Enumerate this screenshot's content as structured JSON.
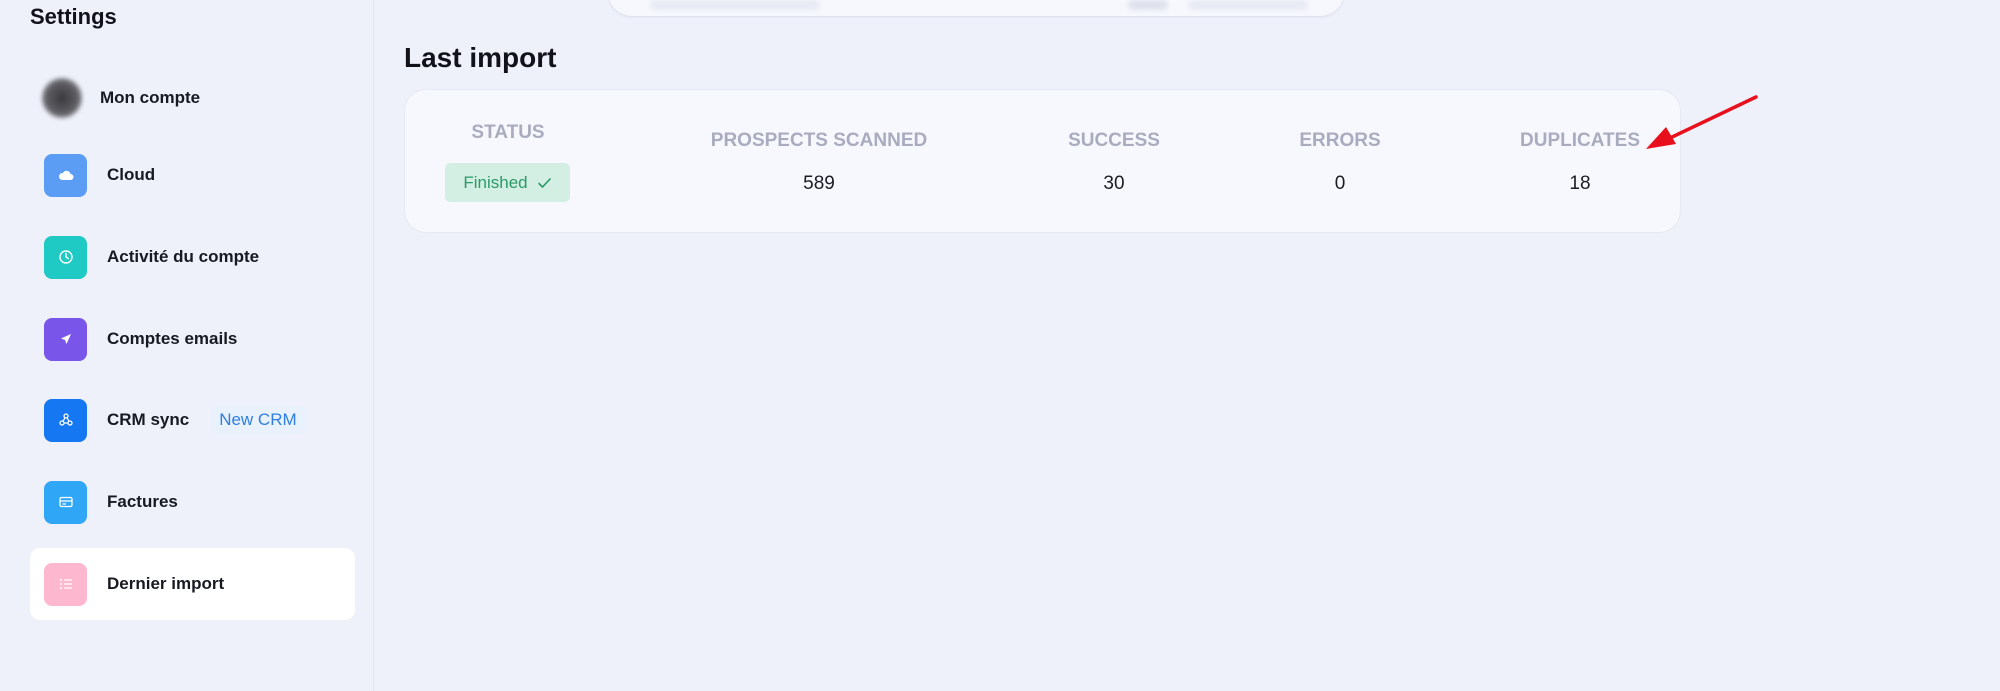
{
  "sidebar": {
    "title": "Settings",
    "items": [
      {
        "label": "Mon compte",
        "icon": "avatar"
      },
      {
        "label": "Cloud",
        "icon": "cloud-icon",
        "color": "#5b9df5"
      },
      {
        "label": "Activité du compte",
        "icon": "clock-icon",
        "color": "#1fc9c4"
      },
      {
        "label": "Comptes emails",
        "icon": "send-icon",
        "color": "#7a55ea"
      },
      {
        "label": "CRM sync",
        "icon": "sync-icon",
        "color": "#1677f2",
        "badge": "New CRM"
      },
      {
        "label": "Factures",
        "icon": "invoice-icon",
        "color": "#2fa6f6"
      },
      {
        "label": "Dernier import",
        "icon": "list-icon",
        "color": "#fdb7cf",
        "active": true
      }
    ]
  },
  "main": {
    "section_title": "Last import",
    "table": {
      "headers": [
        "STATUS",
        "PROSPECTS SCANNED",
        "SUCCESS",
        "ERRORS",
        "DUPLICATES"
      ],
      "status": "Finished",
      "values": {
        "prospects_scanned": "589",
        "success": "30",
        "errors": "0",
        "duplicates": "18"
      }
    }
  },
  "colors": {
    "background": "#eef0fa",
    "card": "#f7f8fd",
    "status_badge_bg": "#d3efe3",
    "status_badge_text": "#2a9a68",
    "annotation_arrow": "#e8101c"
  }
}
